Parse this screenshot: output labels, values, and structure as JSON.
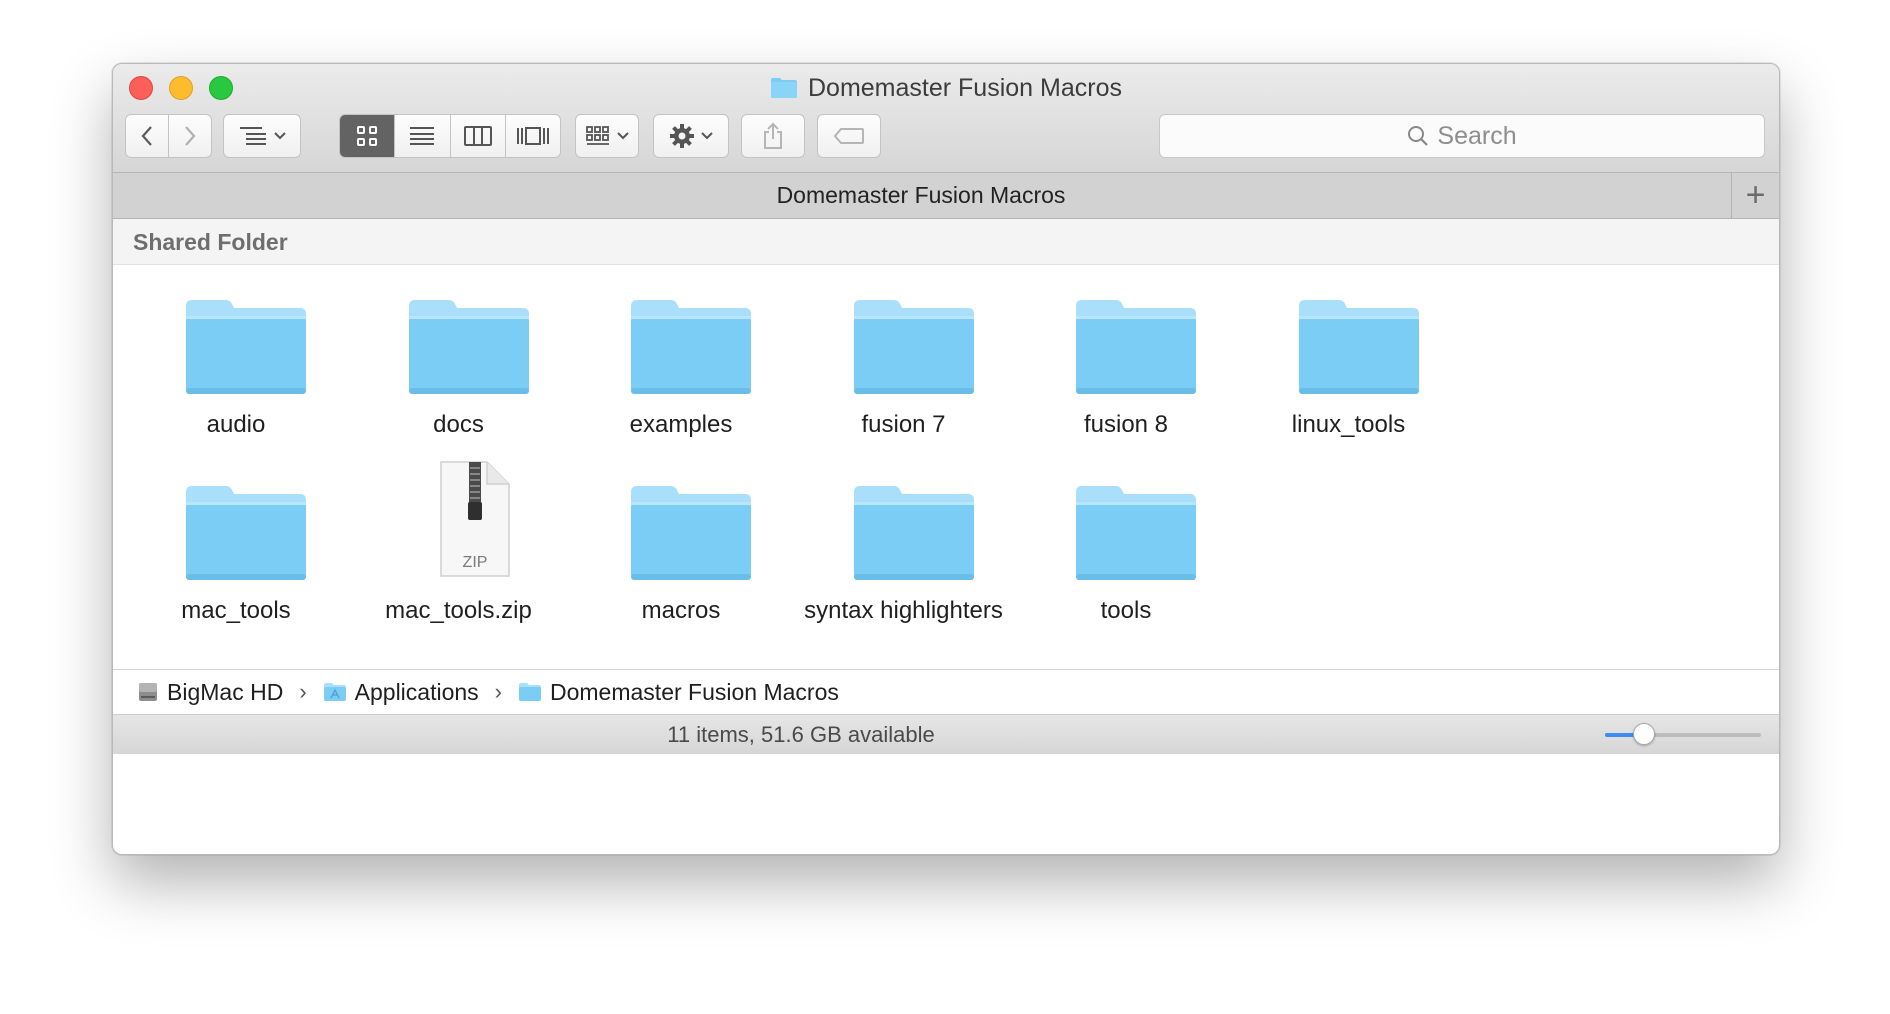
{
  "window": {
    "title": "Domemaster Fusion Macros"
  },
  "toolbar": {
    "back_icon": "chevron-left-icon",
    "forward_icon": "chevron-right-icon",
    "arrange_icon": "list-arrange-icon",
    "view_modes": [
      "icon-view",
      "list-view",
      "column-view",
      "cover-flow-view"
    ],
    "active_view": "icon-view",
    "group_icon": "group-icon",
    "action_icon": "gear-icon",
    "share_icon": "share-icon",
    "tag_icon": "tag-icon",
    "search_placeholder": "Search"
  },
  "tab": {
    "title": "Domemaster Fusion Macros",
    "add_label": "+"
  },
  "section": {
    "title": "Shared Folder"
  },
  "items": [
    {
      "name": "audio",
      "kind": "folder"
    },
    {
      "name": "docs",
      "kind": "folder"
    },
    {
      "name": "examples",
      "kind": "folder"
    },
    {
      "name": "fusion 7",
      "kind": "folder"
    },
    {
      "name": "fusion 8",
      "kind": "folder"
    },
    {
      "name": "linux_tools",
      "kind": "folder"
    },
    {
      "name": "mac_tools",
      "kind": "folder"
    },
    {
      "name": "mac_tools.zip",
      "kind": "zip",
      "badge": "ZIP"
    },
    {
      "name": "macros",
      "kind": "folder"
    },
    {
      "name": "syntax highlighters",
      "kind": "folder"
    },
    {
      "name": "tools",
      "kind": "folder"
    }
  ],
  "path": [
    {
      "name": "BigMac HD",
      "icon": "hard-drive-icon"
    },
    {
      "name": "Applications",
      "icon": "applications-folder-icon"
    },
    {
      "name": "Domemaster Fusion Macros",
      "icon": "folder-icon"
    }
  ],
  "status": {
    "text": "11 items, 51.6 GB available",
    "icon_size_fraction": 0.25
  },
  "colors": {
    "folder": "#7ccdf6",
    "folder_tab": "#a9dffa",
    "accent": "#3b8df3"
  }
}
